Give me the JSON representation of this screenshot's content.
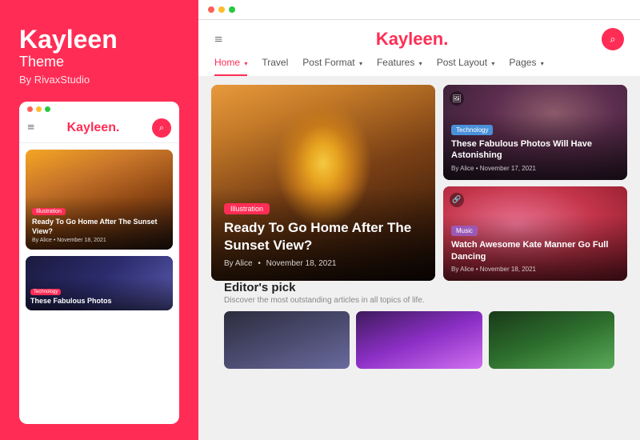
{
  "left": {
    "brand": "Kayleen",
    "theme_label": "Theme",
    "by_label": "By RivaxStudio",
    "mobile_preview_dots": [
      "red",
      "yellow",
      "green"
    ],
    "mobile_logo": "Kayleen",
    "mobile_logo_dot": ".",
    "mobile_main_card": {
      "badge": "Illustration",
      "title": "Ready To Go Home After The Sunset View?",
      "meta": "By Alice  •  November 18, 2021"
    },
    "mobile_small_card": {
      "badge": "Technology",
      "title": "These Fabulous Photos"
    }
  },
  "right": {
    "browser_dots": [
      "red",
      "yellow",
      "green"
    ],
    "header": {
      "hamburger": "≡",
      "logo": "Kayleen",
      "logo_dot": ".",
      "search_icon": "🔍"
    },
    "nav": {
      "items": [
        {
          "label": "Home",
          "active": true,
          "has_caret": true
        },
        {
          "label": "Travel",
          "active": false,
          "has_caret": false
        },
        {
          "label": "Post Format",
          "active": false,
          "has_caret": true
        },
        {
          "label": "Features",
          "active": false,
          "has_caret": true
        },
        {
          "label": "Post Layout",
          "active": false,
          "has_caret": true
        },
        {
          "label": "Pages",
          "active": false,
          "has_caret": true
        }
      ]
    },
    "main_card": {
      "badge": "Illustration",
      "title": "Ready To Go Home After The Sunset View?",
      "meta_author": "By Alice",
      "meta_date": "November 18, 2021"
    },
    "side_card_1": {
      "badge": "Technology",
      "badge_color": "tech",
      "title": "These Fabulous Photos Will Have Astonishing",
      "meta_author": "By Alice",
      "meta_date": "November 17, 2021",
      "icon": "🖼"
    },
    "side_card_2": {
      "badge": "Music",
      "badge_color": "music",
      "title": "Watch Awesome Kate Manner Go Full Dancing",
      "meta_author": "By Alice",
      "meta_date": "November 18, 2021",
      "icon": "🔗"
    },
    "editors_pick": {
      "title": "Editor's pick",
      "subtitle": "Discover the most outstanding articles in all topics of life."
    }
  }
}
